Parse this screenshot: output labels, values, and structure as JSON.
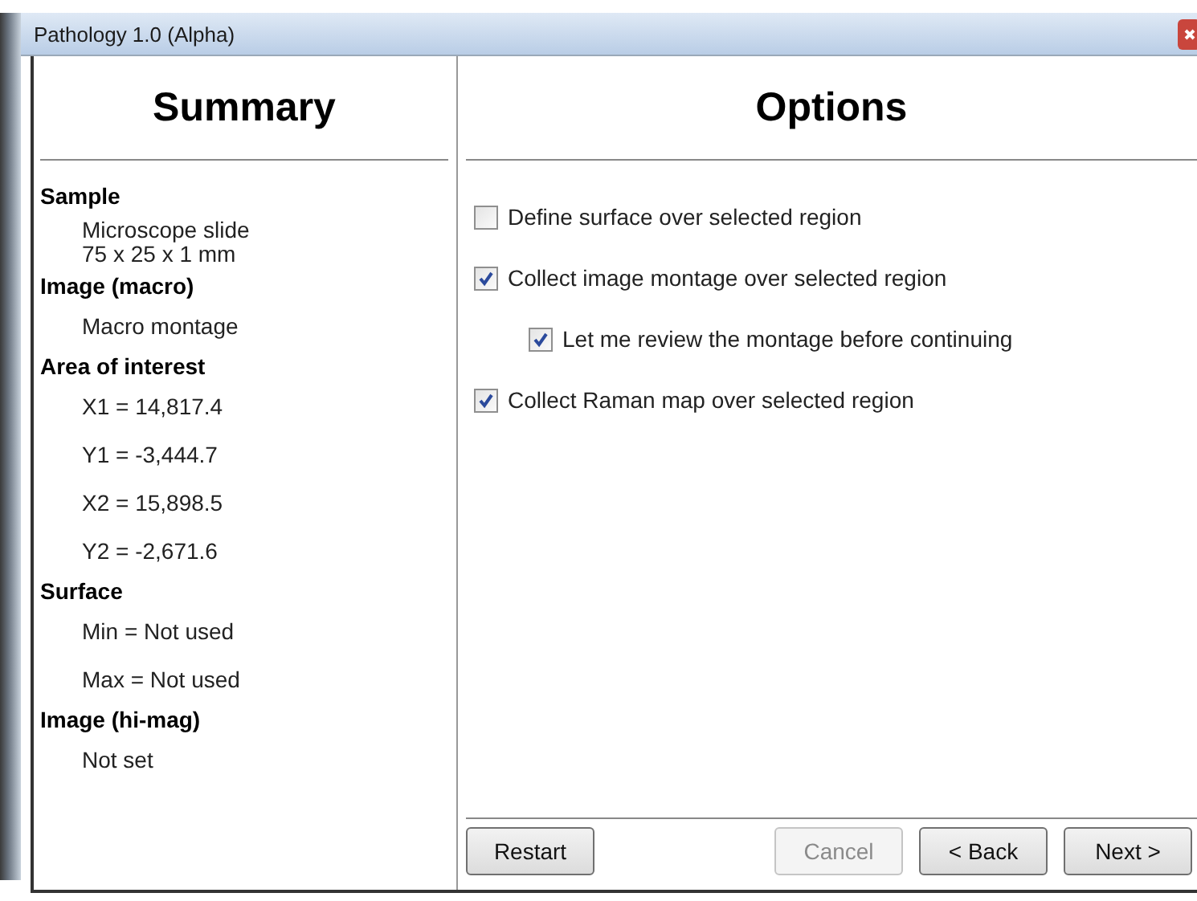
{
  "window": {
    "title": "Pathology 1.0 (Alpha)"
  },
  "summary": {
    "title": "Summary",
    "sections": [
      {
        "heading": "Sample",
        "compact": true,
        "items": [
          "Microscope slide",
          "75 x 25 x 1 mm"
        ]
      },
      {
        "heading": "Image (macro)",
        "compact": false,
        "items": [
          "Macro montage"
        ]
      },
      {
        "heading": "Area of interest",
        "compact": false,
        "items": [
          "X1 = 14,817.4",
          "Y1 = -3,444.7",
          "X2 = 15,898.5",
          "Y2 = -2,671.6"
        ]
      },
      {
        "heading": "Surface",
        "compact": false,
        "items": [
          "Min = Not used",
          "Max = Not used"
        ]
      },
      {
        "heading": "Image (hi-mag)",
        "compact": false,
        "items": [
          "Not set"
        ]
      }
    ]
  },
  "options": {
    "title": "Options",
    "items": [
      {
        "label": "Define surface over selected region",
        "checked": false
      },
      {
        "label": "Collect image montage over selected region",
        "checked": true,
        "children": [
          {
            "label": "Let me review the montage before continuing",
            "checked": true
          }
        ]
      },
      {
        "label": "Collect Raman map over selected region",
        "checked": true
      }
    ]
  },
  "buttons": [
    {
      "label": "Restart",
      "disabled": false
    },
    {
      "label": "Cancel",
      "disabled": true
    },
    {
      "label": "< Back",
      "disabled": false
    },
    {
      "label": "Next >",
      "disabled": false
    }
  ]
}
